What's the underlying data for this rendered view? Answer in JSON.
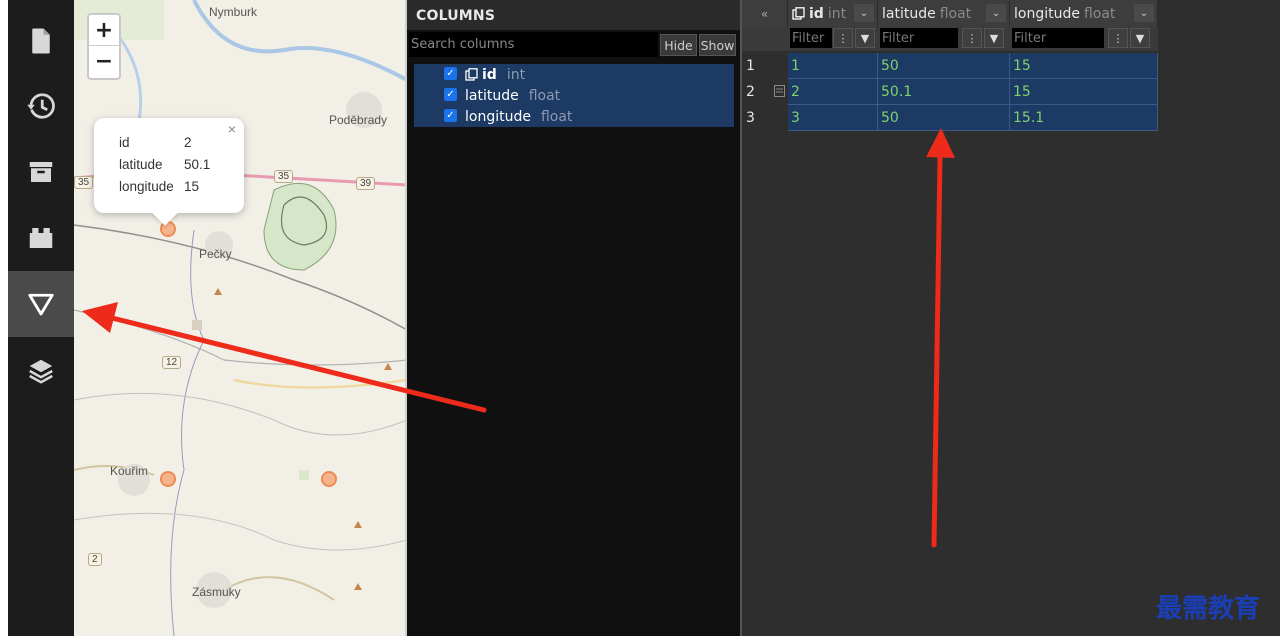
{
  "sidebar": {
    "items": [
      {
        "icon": "file-icon"
      },
      {
        "icon": "history-icon"
      },
      {
        "icon": "archive-icon"
      },
      {
        "icon": "widgets-icon"
      },
      {
        "icon": "filter-icon",
        "active": true
      },
      {
        "icon": "layers-icon"
      }
    ]
  },
  "map": {
    "zoom_in": "+",
    "zoom_out": "−",
    "places": {
      "nymburk": "Nymburk",
      "podebrady": "Poděbrady",
      "pecky": "Pečky",
      "kourim": "Kouřim",
      "zasmuky": "Zásmuky"
    },
    "road_shields": [
      "35",
      "35",
      "39",
      "12",
      "2"
    ],
    "popup": {
      "close": "×",
      "rows": [
        {
          "key": "id",
          "value": "2"
        },
        {
          "key": "latitude",
          "value": "50.1"
        },
        {
          "key": "longitude",
          "value": "15"
        }
      ]
    },
    "marker_color": "#f6b48c"
  },
  "columns_panel": {
    "title": "COLUMNS",
    "search_placeholder": "Search columns",
    "hide_label": "Hide",
    "show_label": "Show",
    "items": [
      {
        "name": "id",
        "type": "int",
        "checked": true
      },
      {
        "name": "latitude",
        "type": "float",
        "checked": true
      },
      {
        "name": "longitude",
        "type": "float",
        "checked": true
      }
    ]
  },
  "grid": {
    "collapse_label": "«",
    "headers": [
      {
        "name": "id",
        "type": "int"
      },
      {
        "name": "latitude",
        "type": "float"
      },
      {
        "name": "longitude",
        "type": "float"
      }
    ],
    "filter_placeholder": "Filter",
    "rows": [
      {
        "num": "1",
        "cells": [
          "1",
          "50",
          "15"
        ]
      },
      {
        "num": "2",
        "cells": [
          "2",
          "50.1",
          "15"
        ]
      },
      {
        "num": "3",
        "cells": [
          "3",
          "50",
          "15.1"
        ]
      }
    ],
    "value_color": "#7fd36e",
    "selection_color": "#1c3a63"
  },
  "annotations": {
    "arrow_color": "#ee2a1a"
  },
  "watermark": "最需教育"
}
